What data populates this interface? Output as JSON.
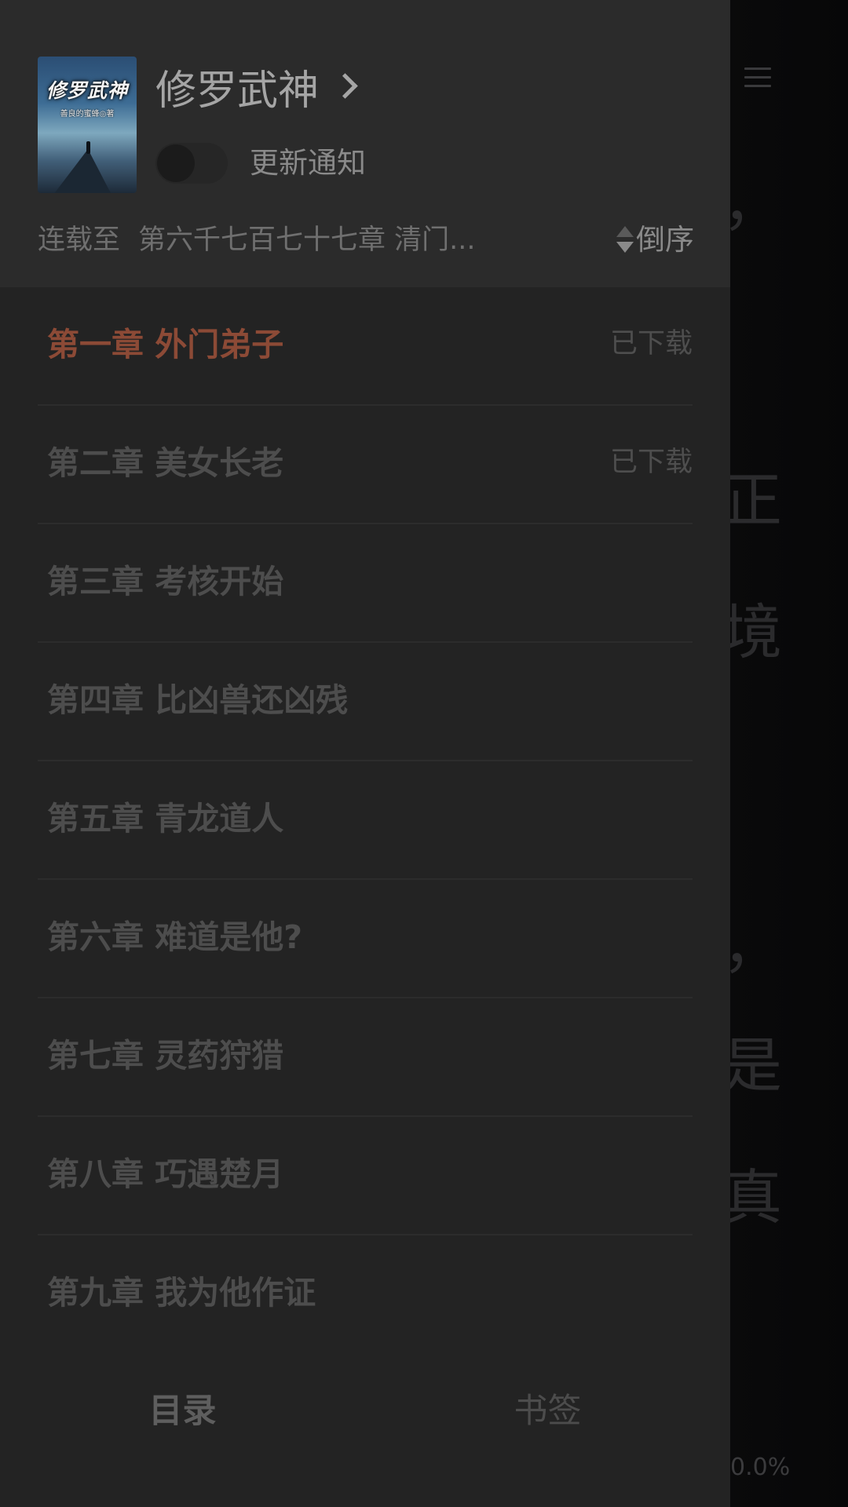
{
  "reader": {
    "background_chars": [
      "，",
      "正",
      "境",
      "，",
      "是",
      "真"
    ],
    "progress": "0.0%"
  },
  "book": {
    "title": "修罗武神",
    "cover": {
      "title": "修罗武神",
      "author": "善良的蜜蜂◎著"
    },
    "notification": {
      "label": "更新通知",
      "enabled": false
    },
    "serial_label": "连载至",
    "latest_chapter": "第六千七百七十七章 清门...",
    "sort_label": "倒序"
  },
  "chapters": [
    {
      "title": "第一章 外门弟子",
      "status": "已下载",
      "current": true
    },
    {
      "title": "第二章 美女长老",
      "status": "已下载",
      "current": false
    },
    {
      "title": "第三章 考核开始",
      "status": "",
      "current": false
    },
    {
      "title": "第四章 比凶兽还凶残",
      "status": "",
      "current": false
    },
    {
      "title": "第五章 青龙道人",
      "status": "",
      "current": false
    },
    {
      "title": "第六章 难道是他?",
      "status": "",
      "current": false
    },
    {
      "title": "第七章 灵药狩猎",
      "status": "",
      "current": false
    },
    {
      "title": "第八章 巧遇楚月",
      "status": "",
      "current": false
    },
    {
      "title": "第九章 我为他作证",
      "status": "",
      "current": false
    }
  ],
  "tabs": {
    "catalog": "目录",
    "bookmark": "书签",
    "active": "catalog"
  },
  "colors": {
    "current_chapter": "#8c4a36",
    "drawer_background": "#232323",
    "header_background": "#2b2b2b"
  },
  "icons": {
    "menu": "hamburger-menu-icon",
    "title_arrow": "chevron-right-icon",
    "sort": "sort-icon"
  }
}
